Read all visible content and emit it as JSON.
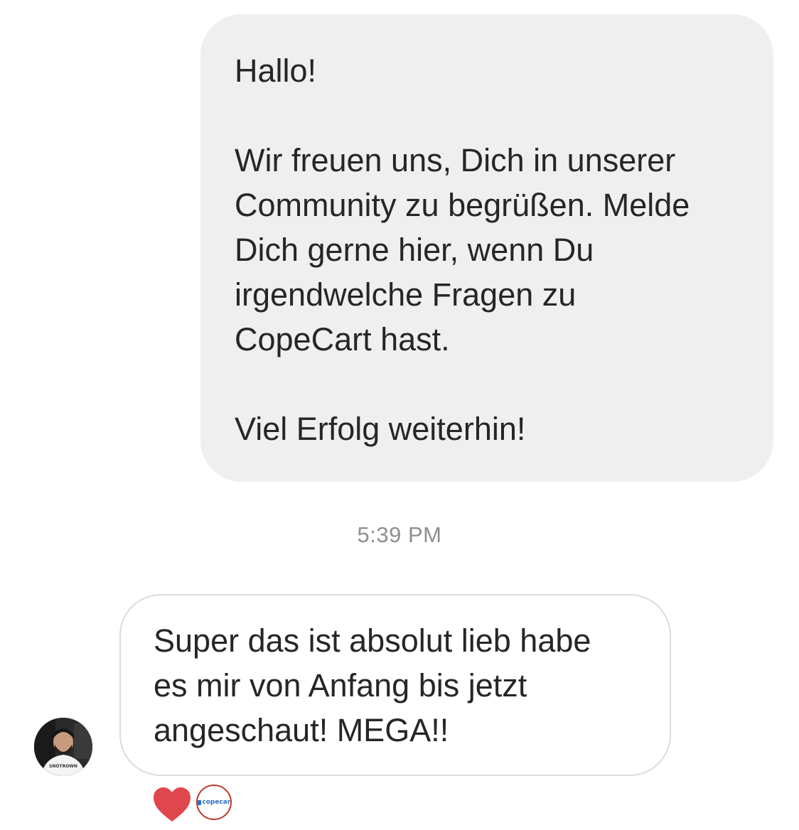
{
  "outgoing_message": {
    "paragraphs": [
      [
        "Hallo!"
      ],
      [
        "Wir freuen uns, Dich in unserer",
        "Community zu begrüßen. Melde",
        "Dich gerne hier, wenn Du",
        "irgendwelche Fragen zu",
        "CopeCart hast."
      ],
      [
        "Viel Erfolg weiterhin!"
      ]
    ]
  },
  "timestamp": "5:39 PM",
  "incoming_message": {
    "lines": [
      "Super das ist absolut lieb habe",
      "es mir von Anfang bis jetzt",
      "angeschaut! MEGA!!"
    ],
    "avatar_icon": "user-avatar-icon",
    "avatar_shirt_text": "SNOTROWN"
  },
  "reactions": {
    "heart_color": "#e0474c",
    "reactor_logo_text": "copecart",
    "reactor_border_color": "#c0392b"
  },
  "colors": {
    "outgoing_bubble_bg": "#efefef",
    "incoming_bubble_border": "#dbdbdb",
    "timestamp": "#8e8e8e",
    "text": "#262626"
  }
}
